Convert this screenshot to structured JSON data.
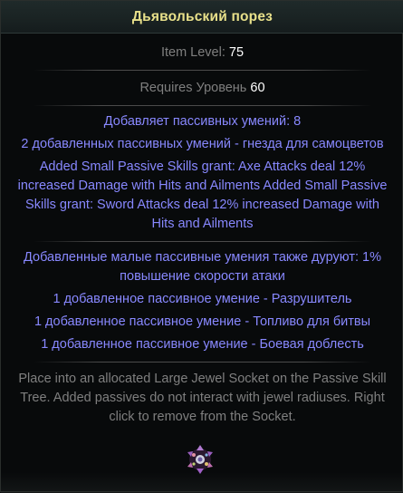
{
  "item": {
    "name": "Дьявольский порез",
    "item_level_label": "Item Level:",
    "item_level_value": "75",
    "requires_label": "Requires Уровень",
    "requires_value": "60"
  },
  "mods": {
    "passives_added": "Добавляет пассивных умений: 8",
    "sockets": "2 добавленных пассивных умений - гнезда для самоцветов",
    "grant_lines": [
      "Added Small Passive Skills grant: Axe Attacks deal 12%",
      "increased Damage with Hits and Ailments Added Small Passive",
      "Skills grant: Sword Attacks deal 12% increased Damage with",
      "Hits and Ailments"
    ],
    "small_also_lines": [
      "Добавленные малые пассивные умения также дуруют: 1%",
      "повышение скорости атаки"
    ],
    "notable_1": "1 добавленное пассивное умение - Разрушитель",
    "notable_2": "1 добавленное пассивное умение - Топливо для битвы",
    "notable_3": "1 добавленное пассивное умение - Боевая доблесть"
  },
  "description": [
    "Place into an allocated Large Jewel Socket on the Passive Skill",
    "Tree. Added passives do not interact with jewel radiuses. Right",
    "click to remove from the Socket."
  ],
  "icons": {
    "jewel": "cluster-jewel-icon"
  },
  "colors": {
    "title": "#e8e08a",
    "label": "#7f7f7f",
    "value": "#ffffff",
    "magic_mod": "#8888ff"
  }
}
